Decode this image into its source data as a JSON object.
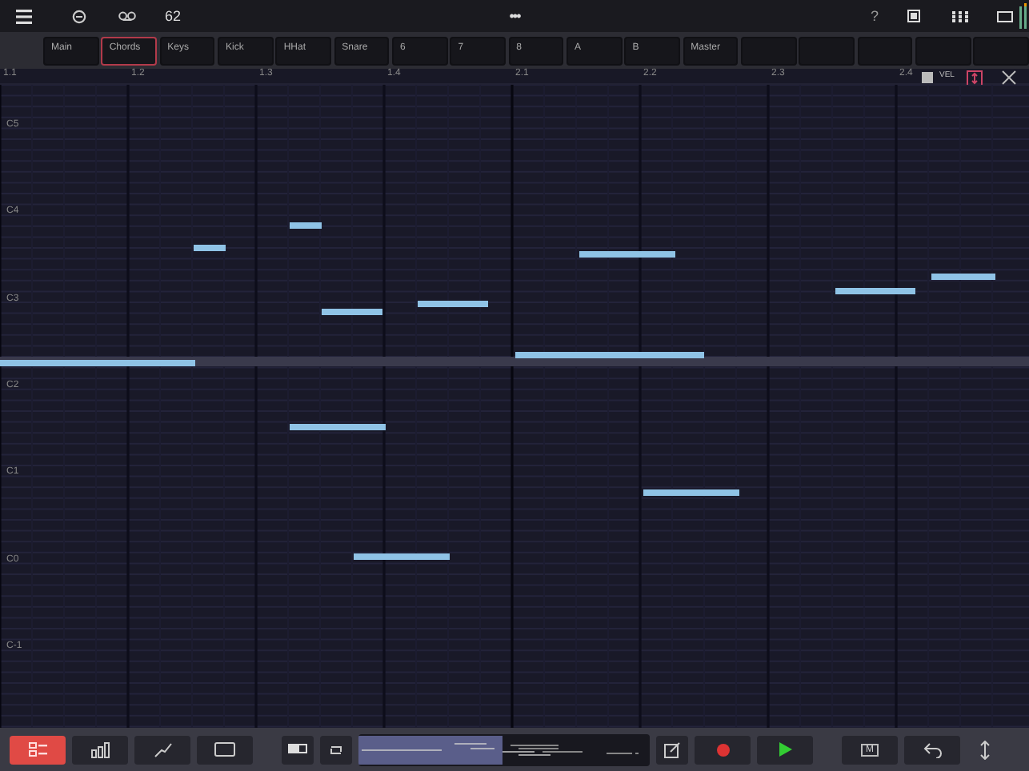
{
  "top_bar": {
    "tempo": "62",
    "more": "•••",
    "help": "?"
  },
  "tracks": [
    {
      "label": "Main",
      "selected": false
    },
    {
      "label": "Chords",
      "selected": true
    },
    {
      "label": "Keys",
      "selected": false
    },
    {
      "label": "Kick",
      "selected": false
    },
    {
      "label": "HHat",
      "selected": false
    },
    {
      "label": "Snare",
      "selected": false
    },
    {
      "label": "6",
      "selected": false
    },
    {
      "label": "7",
      "selected": false
    },
    {
      "label": "8",
      "selected": false
    },
    {
      "label": "A",
      "selected": false
    },
    {
      "label": "B",
      "selected": false
    },
    {
      "label": "Master",
      "selected": false
    }
  ],
  "ruler": [
    "1.1",
    "1.2",
    "1.3",
    "1.4",
    "2.1",
    "2.2",
    "2.3",
    "2.4"
  ],
  "editor_tools": {
    "velocity_label": "VEL"
  },
  "octaves": [
    "C5",
    "C4",
    "C3",
    "C2",
    "C1",
    "C0",
    "C-1"
  ],
  "bottom_tools": [
    {
      "kind": "edit",
      "selected": true
    },
    {
      "kind": "bars",
      "selected": false
    },
    {
      "kind": "curve",
      "selected": false
    },
    {
      "kind": "rect",
      "selected": false
    }
  ],
  "transport": {
    "mixer_label": "M"
  }
}
